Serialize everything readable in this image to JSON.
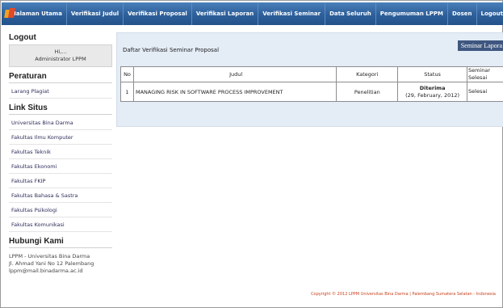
{
  "nav": {
    "items": [
      "Halaman Utama",
      "Verifikasi Judul",
      "Verifikasi Proposal",
      "Verifikasi Laporan",
      "Verifikasi Seminar",
      "Data Seluruh",
      "Pengumuman LPPM",
      "Dosen",
      "Logout"
    ]
  },
  "sidebar": {
    "logout_title": "Logout",
    "user_greeting": "Hi,...",
    "user_name": "Administrator LPPM",
    "peraturan_title": "Peraturan",
    "peraturan_links": [
      "Larang Plagiat"
    ],
    "link_situs_title": "Link Situs",
    "link_situs": [
      "Universitas Bina Darma",
      "Fakultas Ilmu Komputer",
      "Fakultas Teknik",
      "Fakultas Ekonomi",
      "Fakultas FKIP",
      "Fakultas Bahasa & Sastra",
      "Fakultas Psikologi",
      "Fakultas Komunikasi"
    ],
    "hubungi_title": "Hubungi Kami",
    "contact_lines": [
      "LPPM - Universitas Bina Darma",
      "Jl. Ahmad Yani No 12 Palembang",
      "lppm@mail.binadarma.ac.id"
    ]
  },
  "main": {
    "title": "Daftar Verifikasi Seminar Proposal",
    "report_button": "Seminar Lapora",
    "headers": {
      "no": "No",
      "judul": "Judul",
      "kategori": "Kategori",
      "status": "Status",
      "seminar_1": "Seminar",
      "seminar_2": "Selesai"
    },
    "rows": [
      {
        "no": "1",
        "judul": "MANAGING RISK IN SOFTWARE PROCESS IMPROVEMENT",
        "kategori": "Penelitian",
        "status": "Diterima",
        "status_date": "(29, February, 2012)",
        "seminar": "Selesai"
      }
    ]
  },
  "footer": "Copyright © 2012 LPPM Universitas Bina Darma | Palembang Sumatera Selatan - Indonesia",
  "colors": {
    "nav_bg": "#2d5f9a",
    "main_bg": "#e4ecf6",
    "button_bg": "#3f5780",
    "footer_text": "#c8421e"
  }
}
